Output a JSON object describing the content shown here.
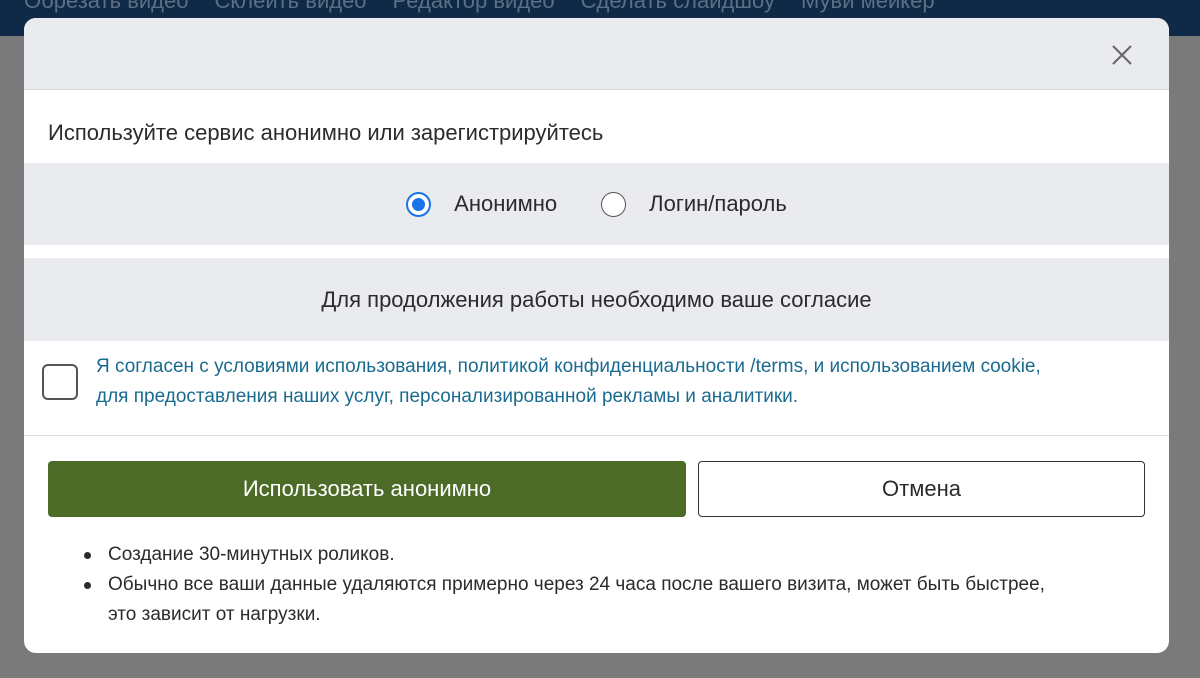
{
  "nav": {
    "links": [
      "Обрезать видео",
      "Склеить видео",
      "Редактор видео",
      "Сделать слайдшоу",
      "Муви мейкер"
    ]
  },
  "modal": {
    "close_icon": "close-icon",
    "intro": "Используйте сервис анонимно или зарегистрируйтесь",
    "modes": {
      "anonymous_label": "Анонимно",
      "anonymous_selected": true,
      "login_label": "Логин/пароль",
      "login_selected": false
    },
    "consent_title": "Для продолжения работы необходимо ваше согласие",
    "agree": {
      "checked": false,
      "line1": "Я согласен с условиями использования, политикой конфиденциальности /terms, и использованием cookie,",
      "line2": "для предоставления наших услуг, персонализированной рекламы и аналитики."
    },
    "buttons": {
      "primary_label": "Использовать анонимно",
      "cancel_label": "Отмена"
    },
    "info": {
      "item1": "Создание 30-минутных роликов.",
      "item2_line1": "Обычно все ваши данные удаляются примерно через 24 часа после вашего визита, может быть быстрее,",
      "item2_line2": "это зависит от нагрузки."
    }
  },
  "colors": {
    "nav_bg": "#0e2a47",
    "overlay": "#7a7a7a",
    "panel_gray": "#e9ebee",
    "primary_green": "#4b6b26",
    "link_blue": "#1a6b8f",
    "radio_blue": "#1a73e8"
  }
}
